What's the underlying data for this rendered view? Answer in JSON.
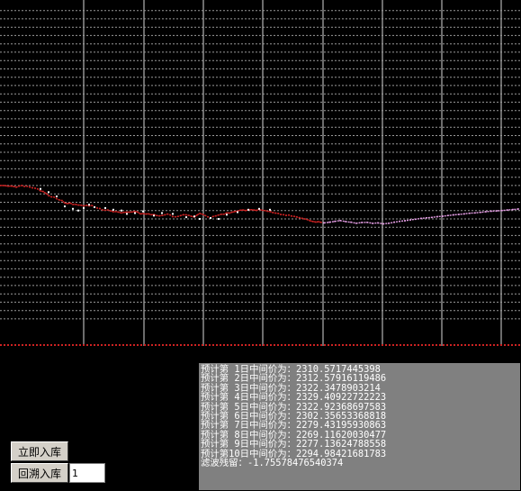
{
  "chart_data": {
    "type": "line",
    "title": "",
    "xlabel": "",
    "ylabel": "",
    "ylim": [
      2240,
      2440
    ],
    "grid": true,
    "series": [
      {
        "role": "history",
        "color": "#cc2222",
        "x": [
          0,
          3,
          6,
          9,
          12,
          15,
          18,
          21,
          24,
          27,
          30,
          33,
          36,
          39,
          42,
          45,
          48,
          51,
          54,
          57,
          60,
          63,
          66,
          69,
          72,
          75,
          78,
          81,
          84,
          87,
          90,
          93,
          96,
          99,
          102,
          105,
          108,
          111,
          114,
          117,
          120,
          123,
          126,
          129,
          132,
          135,
          138,
          141,
          144,
          147,
          150,
          153,
          156,
          159,
          162,
          165,
          168,
          171,
          174,
          177,
          180,
          183,
          186,
          189,
          192,
          195,
          198,
          201,
          204,
          207,
          210,
          213,
          216,
          219,
          222,
          225,
          228,
          231,
          234,
          237,
          240,
          243,
          246,
          249,
          252,
          255,
          258,
          261,
          264,
          267,
          270,
          273,
          276,
          279,
          282,
          285,
          288,
          291,
          294,
          297,
          300,
          303,
          306,
          309,
          312,
          315,
          318,
          321,
          324,
          327,
          330,
          333,
          336,
          339,
          342,
          345,
          348,
          351,
          354,
          357
        ],
        "y": [
          2333.0,
          2333.0,
          2332.9,
          2332.6,
          2332.7,
          2332.5,
          2332.0,
          2332.6,
          2333.0,
          2332.5,
          2332.6,
          2332.1,
          2331.6,
          2331.4,
          2330.9,
          2329.8,
          2329.4,
          2328.3,
          2327.0,
          2326.2,
          2326.1,
          2325.1,
          2324.3,
          2324.0,
          2322.5,
          2322.2,
          2322.5,
          2321.7,
          2321.7,
          2321.3,
          2321.2,
          2320.8,
          2321.1,
          2320.8,
          2321.0,
          2320.2,
          2319.5,
          2319.2,
          2318.3,
          2318.2,
          2318.3,
          2317.8,
          2317.3,
          2317.4,
          2317.0,
          2316.6,
          2316.9,
          2317.0,
          2317.0,
          2317.2,
          2317.5,
          2317.1,
          2316.0,
          2316.1,
          2315.9,
          2316.0,
          2315.5,
          2315.6,
          2315.0,
          2314.8,
          2315.0,
          2315.4,
          2315.9,
          2315.4,
          2314.4,
          2314.2,
          2314.5,
          2315.0,
          2315.5,
          2315.4,
          2315.1,
          2314.5,
          2314.1,
          2315.3,
          2316.2,
          2315.8,
          2315.0,
          2314.2,
          2313.6,
          2314.5,
          2314.8,
          2315.3,
          2315.8,
          2315.8,
          2316.6,
          2316.5,
          2317.0,
          2317.4,
          2317.7,
          2318.2,
          2318.3,
          2318.0,
          2318.5,
          2318.5,
          2318.3,
          2318.1,
          2318.7,
          2318.2,
          2318.0,
          2317.6,
          2317.4,
          2316.8,
          2316.5,
          2316.3,
          2315.6,
          2315.5,
          2315.1,
          2315.3,
          2314.7,
          2314.5,
          2314.1,
          2313.7,
          2313.3,
          2312.9,
          2312.5,
          2311.8,
          2311.4,
          2311.1,
          2311.3,
          2310.9
        ]
      },
      {
        "role": "forecast",
        "color": "#e8a0e8",
        "x": [
          360,
          366,
          372,
          378,
          384,
          390,
          396,
          402,
          408,
          414,
          420,
          426,
          432,
          438,
          444,
          450,
          456,
          462,
          468,
          474,
          480,
          486,
          492,
          498,
          504,
          510,
          516,
          522,
          528,
          534,
          540,
          546,
          552,
          558,
          564,
          570,
          576
        ],
        "y": [
          2310.6,
          2311.0,
          2311.5,
          2312.0,
          2311.4,
          2311.0,
          2310.4,
          2310.8,
          2310.9,
          2310.3,
          2310.6,
          2310.0,
          2310.4,
          2311.0,
          2311.5,
          2311.9,
          2312.4,
          2312.8,
          2313.3,
          2313.6,
          2313.9,
          2314.3,
          2314.6,
          2315.0,
          2315.4,
          2315.7,
          2316.0,
          2316.4,
          2316.6,
          2316.9,
          2317.3,
          2317.6,
          2317.8,
          2318.0,
          2318.3,
          2318.6,
          2318.9
        ]
      },
      {
        "role": "points",
        "color": "#ffffff",
        "x": [
          45,
          54,
          63,
          72,
          81,
          87,
          93,
          99,
          105,
          117,
          126,
          135,
          141,
          150,
          159,
          171,
          180,
          192,
          207,
          216,
          222,
          234,
          243,
          252,
          264,
          276,
          288,
          300
        ],
        "y": [
          2331.0,
          2329.0,
          2326.5,
          2320.5,
          2319.0,
          2318.0,
          2319.5,
          2321.5,
          2320.0,
          2319.5,
          2318.5,
          2318.0,
          2316.0,
          2316.5,
          2317.5,
          2315.0,
          2316.5,
          2316.0,
          2314.0,
          2314.5,
          2313.0,
          2313.5,
          2313.0,
          2315.5,
          2317.0,
          2318.5,
          2319.0,
          2318.5
        ]
      }
    ],
    "hgrid_values": [
      2438,
      2433,
      2428,
      2423,
      2418,
      2413,
      2408,
      2403,
      2398,
      2393,
      2388,
      2383,
      2378,
      2373,
      2368,
      2363,
      2358,
      2353,
      2348,
      2343,
      2338,
      2333,
      2328,
      2323,
      2318,
      2313,
      2308,
      2303,
      2298,
      2293,
      2288,
      2283,
      2278,
      2273,
      2268,
      2263,
      2258,
      2253
    ],
    "vgrid_x": [
      93,
      160,
      226,
      292,
      359,
      425,
      491,
      557
    ]
  },
  "buttons": {
    "immediate_label": "立即入库",
    "backtrack_label": "回溯入库"
  },
  "input": {
    "days_value": "1"
  },
  "forecast_lines": [
    "预计第 1日中间价为：2310.5717445398",
    "预计第 2日中间价为：2312.57916119486",
    "预计第 3日中间价为：2322.3478903214",
    "预计第 4日中间价为：2329.40922722223",
    "预计第 5日中间价为：2322.92368697583",
    "预计第 6日中间价为：2302.35653368818",
    "预计第 7日中间价为：2279.43195930863",
    "预计第 8日中间价为：2269.11620030477",
    "预计第 9日中间价为：2277.13624788558",
    "预计第10日中间价为：2294.98421681783",
    "滤波残留：-1.75578476540374"
  ]
}
